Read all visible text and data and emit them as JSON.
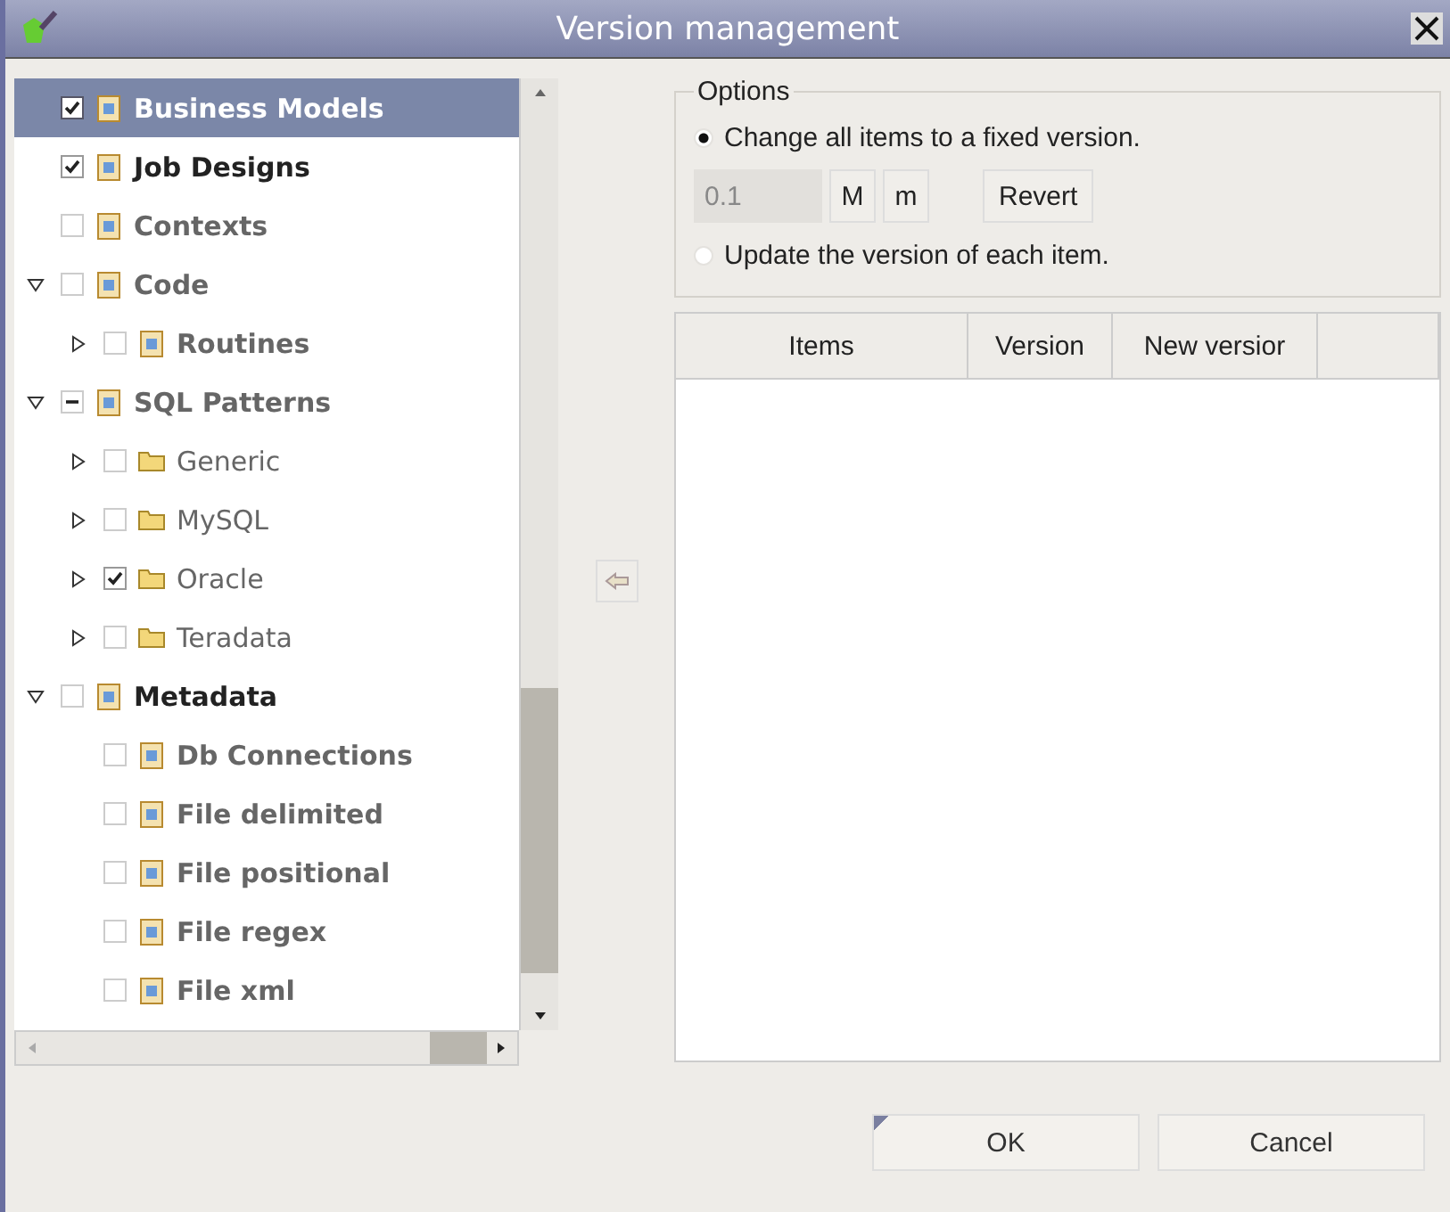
{
  "window": {
    "title": "Version management"
  },
  "tree": {
    "items": [
      {
        "label": "Business Models",
        "kind": "node",
        "checked": true,
        "partial": false,
        "selected": true,
        "dimmed": false
      },
      {
        "label": "Job Designs",
        "kind": "node",
        "checked": true,
        "partial": false,
        "selected": false,
        "dimmed": false
      },
      {
        "label": "Contexts",
        "kind": "node",
        "checked": false,
        "partial": false,
        "selected": false,
        "dimmed": true
      },
      {
        "label": "Code",
        "kind": "node",
        "checked": false,
        "partial": false,
        "selected": false,
        "dimmed": true,
        "expanded": true,
        "children": [
          {
            "label": "Routines",
            "kind": "node",
            "checked": false,
            "partial": false,
            "selected": false,
            "dimmed": true,
            "expanded": false
          }
        ]
      },
      {
        "label": "SQL Patterns",
        "kind": "node",
        "checked": false,
        "partial": true,
        "selected": false,
        "dimmed": true,
        "expanded": true,
        "children": [
          {
            "label": "Generic",
            "kind": "folder",
            "checked": false,
            "partial": false,
            "selected": false,
            "dimmed": true,
            "expanded": false
          },
          {
            "label": "MySQL",
            "kind": "folder",
            "checked": false,
            "partial": false,
            "selected": false,
            "dimmed": true,
            "expanded": false
          },
          {
            "label": "Oracle",
            "kind": "folder",
            "checked": true,
            "partial": false,
            "selected": false,
            "dimmed": true,
            "expanded": false
          },
          {
            "label": "Teradata",
            "kind": "folder",
            "checked": false,
            "partial": false,
            "selected": false,
            "dimmed": true,
            "expanded": false
          }
        ]
      },
      {
        "label": "Metadata",
        "kind": "node",
        "checked": false,
        "partial": false,
        "selected": false,
        "dimmed": false,
        "expanded": true,
        "children": [
          {
            "label": "Db Connections",
            "kind": "node",
            "checked": false,
            "partial": false,
            "selected": false,
            "dimmed": true
          },
          {
            "label": "File delimited",
            "kind": "node",
            "checked": false,
            "partial": false,
            "selected": false,
            "dimmed": true
          },
          {
            "label": "File positional",
            "kind": "node",
            "checked": false,
            "partial": false,
            "selected": false,
            "dimmed": true
          },
          {
            "label": "File regex",
            "kind": "node",
            "checked": false,
            "partial": false,
            "selected": false,
            "dimmed": true
          },
          {
            "label": "File xml",
            "kind": "node",
            "checked": false,
            "partial": false,
            "selected": false,
            "dimmed": true
          }
        ]
      }
    ]
  },
  "options": {
    "title": "Options",
    "radios": [
      {
        "label": "Change all items to a fixed version.",
        "selected": true
      },
      {
        "label": "Update the version of each item.",
        "selected": false
      }
    ],
    "version_field": {
      "value": "0.1",
      "disabled": true
    },
    "buttons": [
      "M",
      "m",
      "Revert"
    ]
  },
  "table": {
    "columns": [
      "Items",
      "Version",
      "New versior"
    ]
  },
  "buttons": [
    "OK",
    "Cancel"
  ]
}
